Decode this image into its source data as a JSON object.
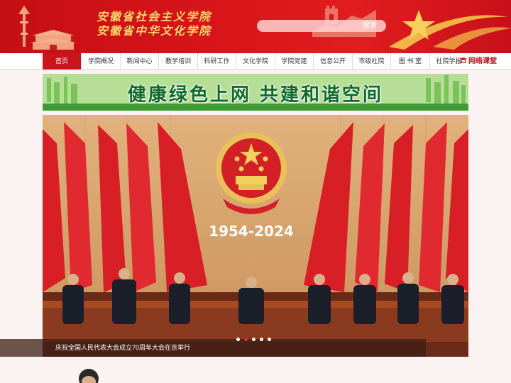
{
  "header": {
    "title_line1": "安徽省社会主义学院",
    "title_line2": "安徽省中华文化学院",
    "search_placeholder": "",
    "search_button": "搜索",
    "colors": {
      "header_red": "#d9151a",
      "title_gold": "#ffd66b"
    }
  },
  "nav": {
    "items": [
      {
        "label": "首页",
        "active": true
      },
      {
        "label": "学院概况"
      },
      {
        "label": "新闻中心"
      },
      {
        "label": "教学培训"
      },
      {
        "label": "科研工作"
      },
      {
        "label": "文化学院"
      },
      {
        "label": "学院党建"
      },
      {
        "label": "信息公开"
      },
      {
        "label": "市级社院"
      },
      {
        "label": "图 书 室"
      },
      {
        "label": "社院学报"
      }
    ],
    "online": "网络课堂"
  },
  "banner": {
    "text": "健康绿色上网 共建和谐空间"
  },
  "slider": {
    "emblem_text": "1954-2024",
    "caption": "庆祝全国人民代表大会成立70周年大会在京举行",
    "slide_count": 5,
    "active_index": 1
  }
}
